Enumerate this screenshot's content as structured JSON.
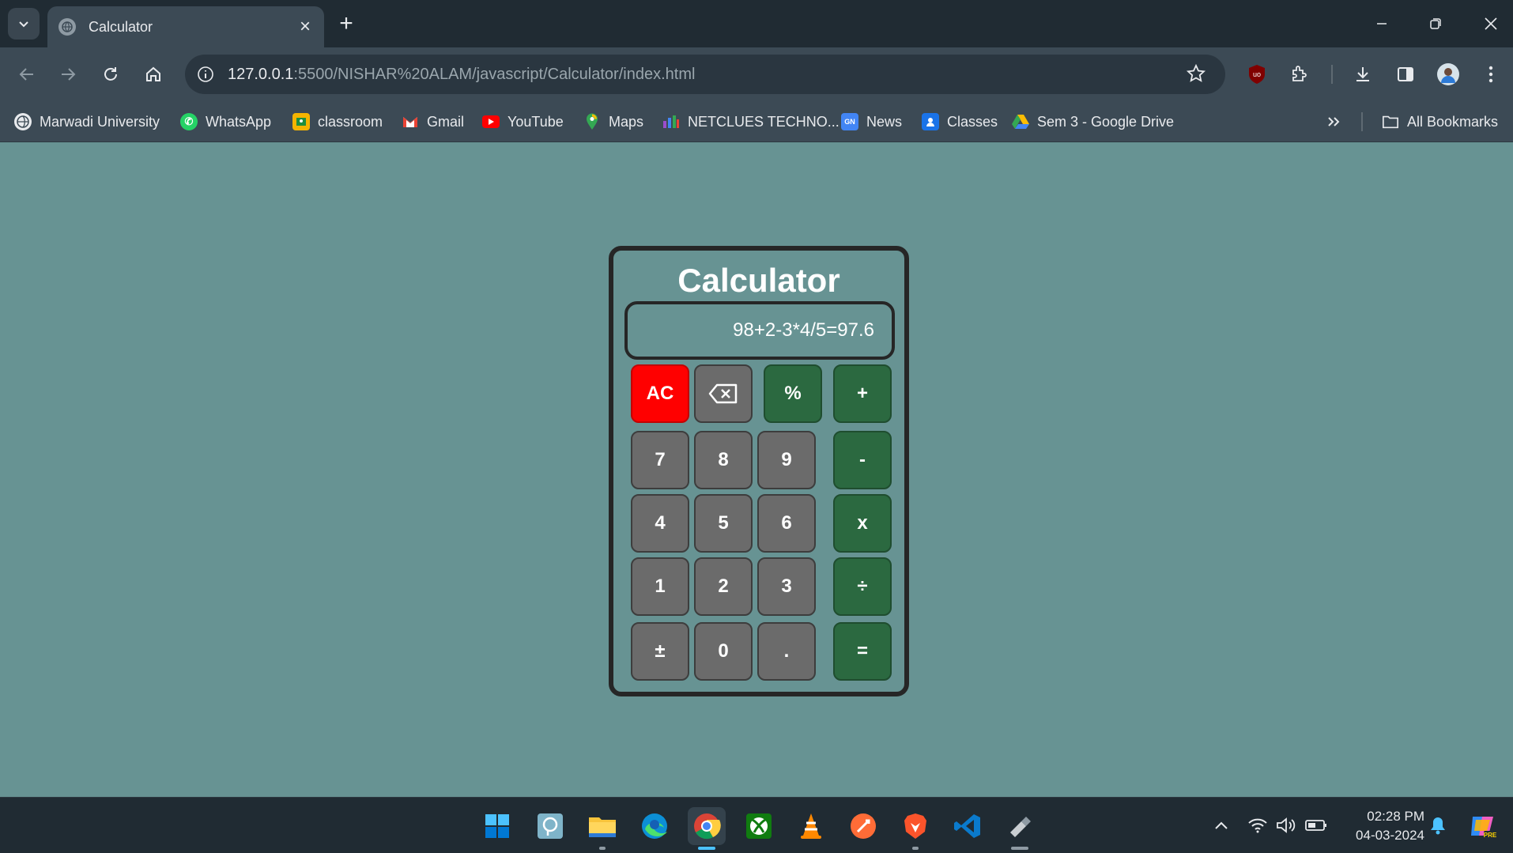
{
  "browser": {
    "tab_title": "Calculator",
    "new_tab_label": "+",
    "url_host": "127.0.0.1",
    "url_rest": ":5500/NISHAR%20ALAM/javascript/Calculator/index.html"
  },
  "bookmarks": [
    {
      "label": "Marwadi University",
      "icon": "globe-icon",
      "color": "#e8eaed"
    },
    {
      "label": "WhatsApp",
      "icon": "whatsapp-icon",
      "color": "#25d366"
    },
    {
      "label": "classroom",
      "icon": "classroom-icon",
      "color": "#f5b400"
    },
    {
      "label": "Gmail",
      "icon": "gmail-icon",
      "color": "#ea4335"
    },
    {
      "label": "YouTube",
      "icon": "youtube-icon",
      "color": "#ff0000"
    },
    {
      "label": "Maps",
      "icon": "maps-icon",
      "color": "#34a853"
    },
    {
      "label": "NETCLUES TECHNO...",
      "icon": "netclues-icon",
      "color": "#9c4dcc"
    },
    {
      "label": "News",
      "icon": "news-icon",
      "color": "#4285f4"
    },
    {
      "label": "Classes",
      "icon": "classes-icon",
      "color": "#1a73e8"
    },
    {
      "label": "Sem 3 - Google Drive",
      "icon": "google-drive-icon",
      "color": "#fbbc04"
    }
  ],
  "all_bookmarks_label": "All Bookmarks",
  "calculator": {
    "title": "Calculator",
    "display": "98+2-3*4/5=97.6",
    "keys": {
      "ac": "AC",
      "percent": "%",
      "plus": "+",
      "k7": "7",
      "k8": "8",
      "k9": "9",
      "minus": "-",
      "k4": "4",
      "k5": "5",
      "k6": "6",
      "multiply": "x",
      "k1": "1",
      "k2": "2",
      "k3": "3",
      "divide": "÷",
      "plusminus": "±",
      "k0": "0",
      "dot": ".",
      "equals": "="
    }
  },
  "taskbar": {
    "time": "02:28 PM",
    "date": "04-03-2024",
    "apps": [
      "windows-start-icon",
      "search-app-icon",
      "file-explorer-icon",
      "edge-icon",
      "chrome-icon",
      "xbox-icon",
      "vlc-icon",
      "postman-icon",
      "brave-icon",
      "vscode-icon",
      "usb-drive-icon"
    ]
  },
  "colors": {
    "page_bg": "#679393",
    "key_gray": "#6b6b6b",
    "key_green": "#2b6940",
    "key_red": "#ff0000"
  }
}
